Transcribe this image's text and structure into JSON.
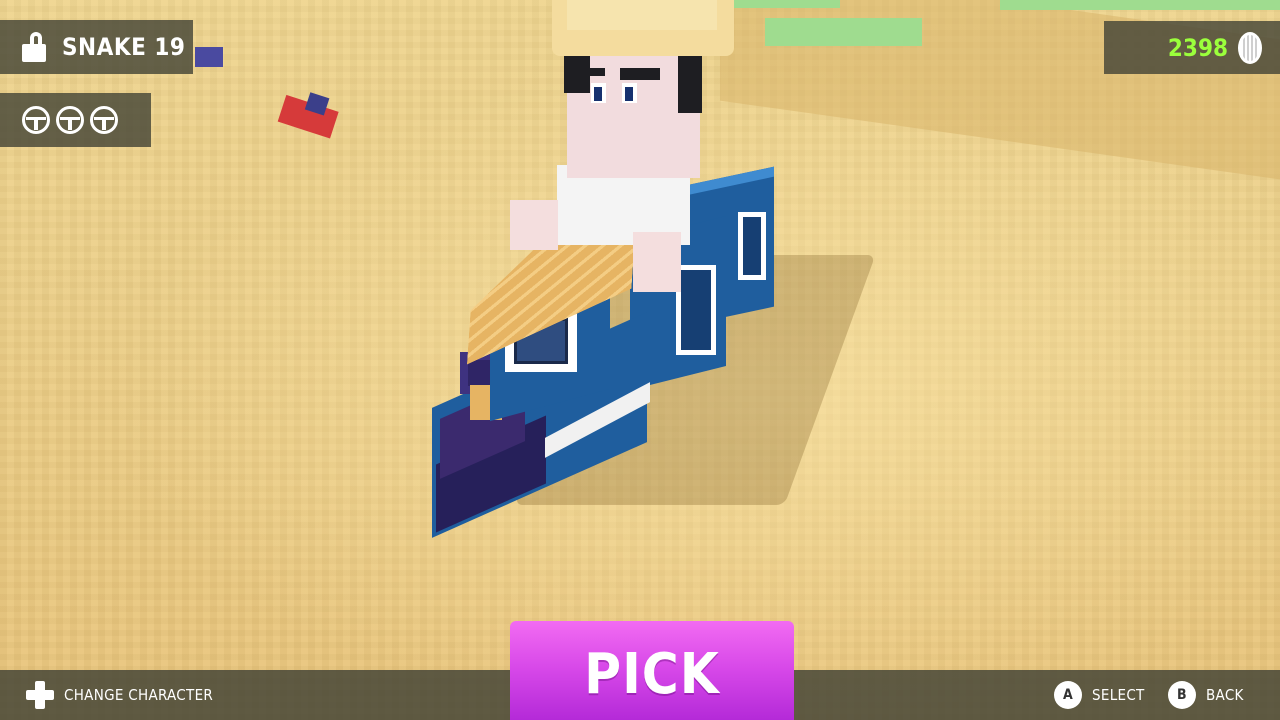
{
  "hud": {
    "character_name": "SNAKE 19",
    "locked": true,
    "wheel_count": 3,
    "coins": "2398"
  },
  "footer": {
    "change_character_label": "CHANGE CHARACTER",
    "select_button_key": "A",
    "select_label": "SELECT",
    "back_button_key": "B",
    "back_label": "BACK"
  },
  "pick_button": {
    "label": "PICK"
  },
  "icons": {
    "lock": "lock-icon",
    "wheel": "steering-wheel-icon",
    "coin": "coin-icon",
    "dpad": "dpad-icon"
  },
  "colors": {
    "hud_panel": "#46463a",
    "coin_text": "#9bff3c",
    "pick_button": "#d647e8",
    "sand": "#e8c47a",
    "train_blue": "#1f5e9e",
    "train_roof": "#e6b463"
  }
}
